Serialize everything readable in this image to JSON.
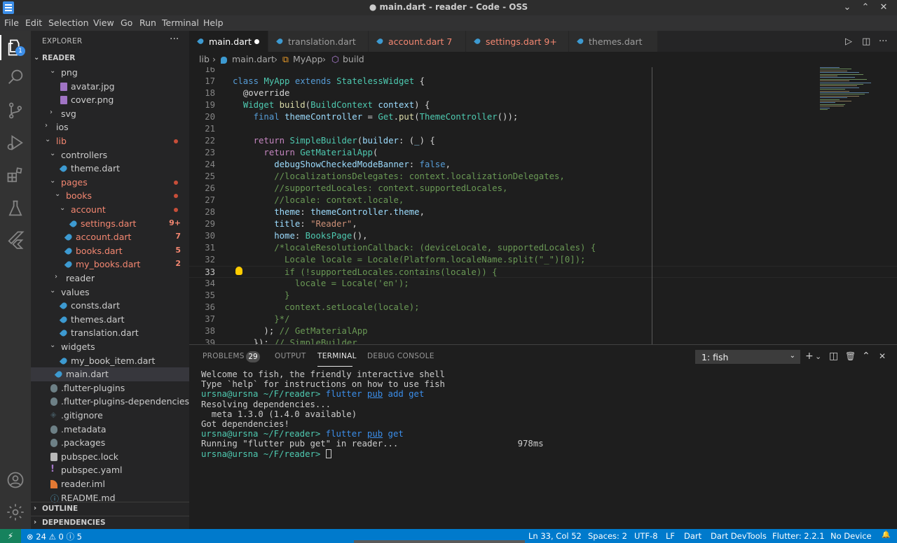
{
  "window": {
    "title": "● main.dart - reader - Code - OSS",
    "minimize": "⌄",
    "restore": "⌃",
    "close": "✕"
  },
  "menu": [
    "File",
    "Edit",
    "Selection",
    "View",
    "Go",
    "Run",
    "Terminal",
    "Help"
  ],
  "activity": {
    "explorer_badge": "1"
  },
  "sidebar": {
    "header": "EXPLORER",
    "more": "···",
    "root": "READER",
    "tree": [
      {
        "name": "png",
        "type": "folder",
        "open": true,
        "depth": 1,
        "y": 0
      },
      {
        "name": "avatar.jpg",
        "type": "img",
        "depth": 2,
        "y": 1
      },
      {
        "name": "cover.png",
        "type": "img",
        "depth": 2,
        "y": 2
      },
      {
        "name": "svg",
        "type": "folder",
        "open": false,
        "depth": 1,
        "y": 3
      },
      {
        "name": "ios",
        "type": "folder",
        "open": false,
        "depth": 0,
        "y": 4
      },
      {
        "name": "lib",
        "type": "folder",
        "open": true,
        "depth": 0,
        "err": true,
        "dot": true
      },
      {
        "name": "controllers",
        "type": "folder",
        "open": true,
        "depth": 1
      },
      {
        "name": "theme.dart",
        "type": "dart",
        "depth": 2
      },
      {
        "name": "pages",
        "type": "folder",
        "open": true,
        "depth": 1,
        "err": true,
        "dot": true
      },
      {
        "name": "books",
        "type": "folder",
        "open": true,
        "depth": 2,
        "err": true,
        "dot": true
      },
      {
        "name": "account",
        "type": "folder",
        "open": true,
        "depth": 3,
        "err": true,
        "dot": true
      },
      {
        "name": "settings.dart",
        "type": "dart",
        "depth": 4,
        "err": true,
        "deco": "9+"
      },
      {
        "name": "account.dart",
        "type": "dart",
        "depth": 3,
        "err": true,
        "deco": "7"
      },
      {
        "name": "books.dart",
        "type": "dart",
        "depth": 3,
        "err": true,
        "deco": "5"
      },
      {
        "name": "my_books.dart",
        "type": "dart",
        "depth": 3,
        "err": true,
        "deco": "2"
      },
      {
        "name": "reader",
        "type": "folder",
        "open": false,
        "depth": 2
      },
      {
        "name": "values",
        "type": "folder",
        "open": true,
        "depth": 1
      },
      {
        "name": "consts.dart",
        "type": "dart",
        "depth": 2
      },
      {
        "name": "themes.dart",
        "type": "dart",
        "depth": 2
      },
      {
        "name": "translation.dart",
        "type": "dart",
        "depth": 2
      },
      {
        "name": "widgets",
        "type": "folder",
        "open": true,
        "depth": 1
      },
      {
        "name": "my_book_item.dart",
        "type": "dart",
        "depth": 2
      },
      {
        "name": "main.dart",
        "type": "dart",
        "depth": 1,
        "selected": true
      },
      {
        "name": ".flutter-plugins",
        "type": "gear",
        "depth": 0
      },
      {
        "name": ".flutter-plugins-dependencies",
        "type": "gear",
        "depth": 0
      },
      {
        "name": ".gitignore",
        "type": "git",
        "depth": 0
      },
      {
        "name": ".metadata",
        "type": "gear",
        "depth": 0
      },
      {
        "name": ".packages",
        "type": "gear",
        "depth": 0
      },
      {
        "name": "pubspec.lock",
        "type": "lock",
        "depth": 0
      },
      {
        "name": "pubspec.yaml",
        "type": "yaml",
        "depth": 0
      },
      {
        "name": "reader.iml",
        "type": "rss",
        "depth": 0
      },
      {
        "name": "README.md",
        "type": "info",
        "depth": 0
      }
    ],
    "outline": "OUTLINE",
    "dependencies": "DEPENDENCIES"
  },
  "tabs": [
    {
      "label": "main.dart",
      "active": true,
      "modified": true
    },
    {
      "label": "translation.dart"
    },
    {
      "label": "account.dart 7",
      "err": true
    },
    {
      "label": "settings.dart 9+",
      "err": true
    },
    {
      "label": "themes.dart"
    }
  ],
  "editor_actions": {
    "run": "▷",
    "split": "◫",
    "more": "···"
  },
  "breadcrumb": {
    "a": "lib",
    "sep1": "›",
    "b": "main.dart",
    "sep2": "›",
    "c": "MyApp",
    "sep3": "›",
    "d": "build"
  },
  "code": {
    "first_line": 16,
    "current_line": 33,
    "lines": [
      "",
      "<span class='k'>class</span> <span class='t'>MyApp</span> <span class='k'>extends</span> <span class='t'>StatelessWidget</span> {",
      "  <span class='p'>@override</span>",
      "  <span class='t'>Widget</span> <span class='f'>build</span>(<span class='t'>BuildContext</span> <span class='v'>context</span>) {",
      "    <span class='k'>final</span> <span class='v'>themeController</span> = <span class='t'>Get</span>.<span class='f'>put</span>(<span class='t'>ThemeController</span>());",
      "",
      "    <span class='kc'>return</span> <span class='t'>SimpleBuilder</span>(<span class='v'>builder</span>: (<span class='v'>_</span>) {",
      "      <span class='kc'>return</span> <span class='t'>GetMaterialApp</span>(",
      "        <span class='v'>debugShowCheckedModeBanner</span>: <span class='k'>false</span>,",
      "        <span class='c'>//localizationsDelegates: context.localizationDelegates,</span>",
      "        <span class='c'>//supportedLocales: context.supportedLocales,</span>",
      "        <span class='c'>//locale: context.locale,</span>",
      "        <span class='v'>theme</span>: <span class='v'>themeController</span>.<span class='v'>theme</span>,",
      "        <span class='v'>title</span>: <span class='s'>\"Reader\"</span>,",
      "        <span class='v'>home</span>: <span class='t'>BooksPage</span>(),",
      "        <span class='c'>/*localeResolutionCallback: (deviceLocale, supportedLocales) {</span>",
      "<span class='c'>          Locale locale = Locale(Platform.localeName.split(\"_\")[0]);</span>",
      "<span class='c'>          if (!supportedLocales.contains(locale)) {</span>",
      "<span class='c'>            locale = Locale('en');</span>",
      "<span class='c'>          }</span>",
      "<span class='c'>          context.setLocale(locale);</span>",
      "<span class='c'>        }*/</span>",
      "      ); <span class='c'>// GetMaterialApp</span>",
      "    }); <span class='c'>// SimpleBuilder</span>"
    ]
  },
  "panel": {
    "tabs": [
      "PROBLEMS",
      "OUTPUT",
      "TERMINAL",
      "DEBUG CONSOLE"
    ],
    "problems_count": "29",
    "terminal_name": "1: fish",
    "actions": {
      "add": "+",
      "add_dd": "⌄",
      "split": "◫",
      "trash": "🗑",
      "max": "⌃",
      "close": "✕"
    }
  },
  "terminal": {
    "welcome1": "Welcome to fish, the friendly interactive shell",
    "welcome2": "Type `help` for instructions on how to use fish",
    "prompt_user": "ursna@ursna",
    "prompt_path": " ~/F/reader>",
    "cmd_flutter": " flutter",
    "cmd_pub": "pub",
    "cmd1_rest": " add get",
    "resolving": "Resolving dependencies...",
    "meta": "  meta 1.3.0 (1.4.0 available)",
    "got": "Got dependencies!",
    "cmd2_rest": " get",
    "running": "Running \"flutter pub get\" in reader...                       978ms"
  },
  "status": {
    "remote": "⚡",
    "errors": "⊗ 24 ⚠ 0 ⓘ 5",
    "ln_col": "Ln 33, Col 52",
    "spaces": "Spaces: 2",
    "encoding": "UTF-8",
    "eol": "LF",
    "language": "Dart",
    "devtools": "Dart DevTools",
    "flutter": "Flutter: 2.2.1",
    "device": "No Device",
    "bell": "🔔"
  }
}
